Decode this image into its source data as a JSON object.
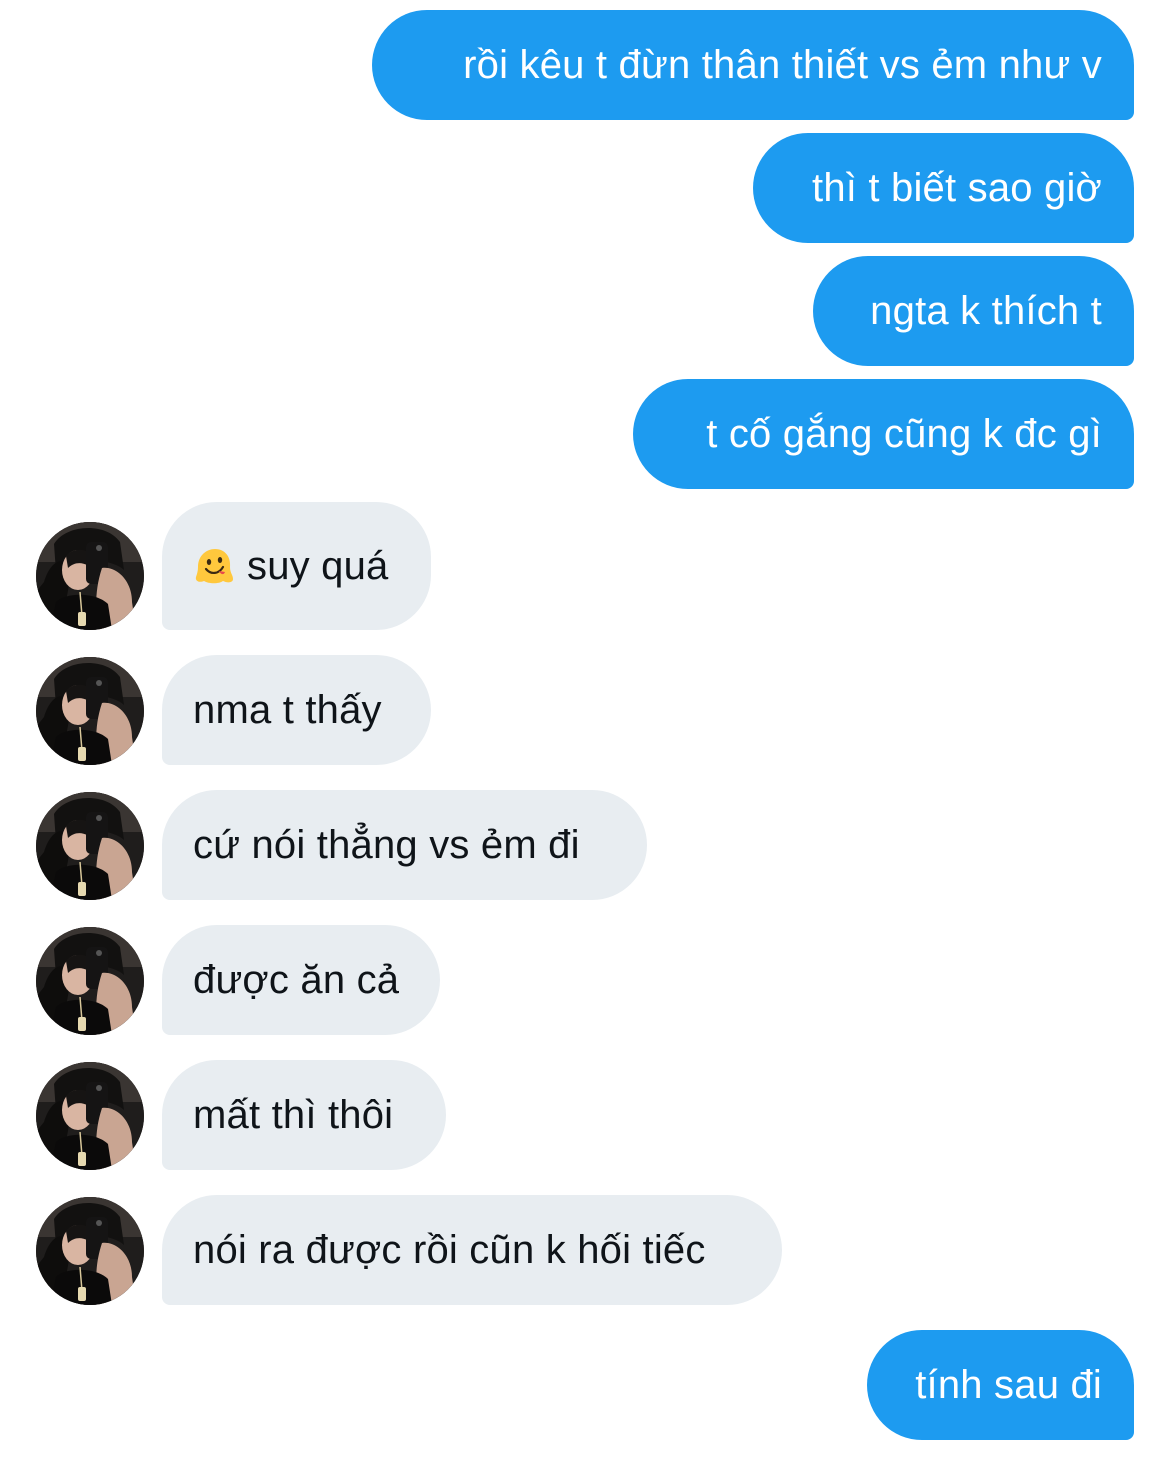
{
  "conversation": {
    "messages": [
      {
        "direction": "sent",
        "text": "rồi kêu t đừn thân thiết vs ẻm như v"
      },
      {
        "direction": "sent",
        "text": "thì t biết sao giờ"
      },
      {
        "direction": "sent",
        "text": "ngta k thích t"
      },
      {
        "direction": "sent",
        "text": "t cố gắng cũng k đc gì"
      },
      {
        "direction": "received",
        "emoji": "melting-face",
        "text": "suy quá"
      },
      {
        "direction": "received",
        "text": "nma t thấy"
      },
      {
        "direction": "received",
        "text": "cứ nói thẳng vs ẻm đi"
      },
      {
        "direction": "received",
        "text": "được ăn cả"
      },
      {
        "direction": "received",
        "text": "mất thì thôi"
      },
      {
        "direction": "received",
        "text": "nói ra được rồi cũn k hối tiếc"
      },
      {
        "direction": "sent",
        "text": "tính sau đi"
      }
    ]
  },
  "colors": {
    "sent_bubble": "#1d9bf0",
    "received_bubble": "#e8edf1",
    "sent_text": "#ffffff",
    "received_text": "#0f1419"
  }
}
